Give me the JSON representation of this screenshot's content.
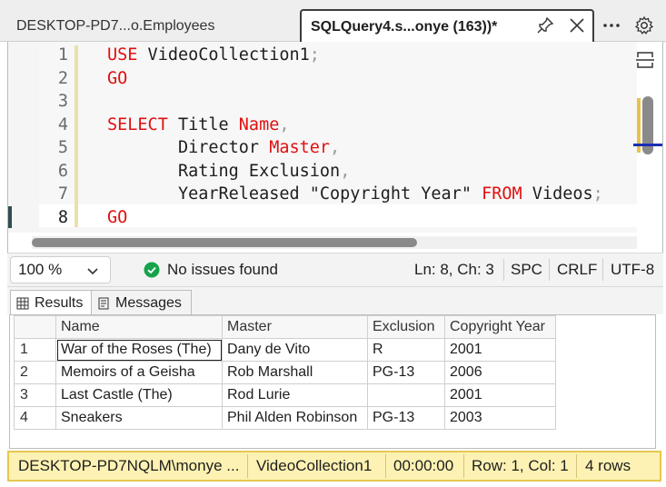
{
  "tabs": {
    "inactive_label": "DESKTOP-PD7...o.Employees",
    "active_label": "SQLQuery4.s...onye (163))*"
  },
  "editor": {
    "line_numbers": [
      "1",
      "2",
      "3",
      "4",
      "5",
      "6",
      "7",
      "8"
    ],
    "lines": [
      [
        {
          "t": "USE",
          "c": "kw"
        },
        {
          "t": " VideoCollection1",
          "c": "id"
        },
        {
          "t": ";",
          "c": "pu"
        }
      ],
      [
        {
          "t": "GO",
          "c": "kw"
        }
      ],
      [],
      [
        {
          "t": "SELECT",
          "c": "kw"
        },
        {
          "t": " Title ",
          "c": "id"
        },
        {
          "t": "Name",
          "c": "kw"
        },
        {
          "t": ",",
          "c": "pu"
        }
      ],
      [
        {
          "t": "       Director ",
          "c": "id"
        },
        {
          "t": "Master",
          "c": "kw"
        },
        {
          "t": ",",
          "c": "pu"
        }
      ],
      [
        {
          "t": "       Rating Exclusion",
          "c": "id"
        },
        {
          "t": ",",
          "c": "pu"
        }
      ],
      [
        {
          "t": "       YearReleased \"Copyright Year\" ",
          "c": "id"
        },
        {
          "t": "FROM",
          "c": "kw"
        },
        {
          "t": " Videos",
          "c": "id"
        },
        {
          "t": ";",
          "c": "pu"
        }
      ],
      [
        {
          "t": "GO",
          "c": "kw"
        }
      ]
    ],
    "current_line": 8
  },
  "editor_status": {
    "zoom": "100 %",
    "issues": "No issues found",
    "cursor": "Ln: 8, Ch: 3",
    "whitespace": "SPC",
    "line_ending": "CRLF",
    "encoding": "UTF-8"
  },
  "result_tabs": {
    "results": "Results",
    "messages": "Messages"
  },
  "grid": {
    "columns": [
      "Name",
      "Master",
      "Exclusion",
      "Copyright Year"
    ],
    "rows": [
      {
        "n": "1",
        "cells": [
          "War of the Roses (The)",
          "Dany de Vito",
          "R",
          "2001"
        ]
      },
      {
        "n": "2",
        "cells": [
          "Memoirs of a Geisha",
          "Rob Marshall",
          "PG-13",
          "2006"
        ]
      },
      {
        "n": "3",
        "cells": [
          "Last Castle (The)",
          "Rod Lurie",
          "",
          "2001"
        ]
      },
      {
        "n": "4",
        "cells": [
          "Sneakers",
          "Phil Alden Robinson",
          "PG-13",
          "2003"
        ]
      }
    ]
  },
  "bottom_status": {
    "server": "DESKTOP-PD7NQLM\\monye ...",
    "database": "VideoCollection1",
    "elapsed": "00:00:00",
    "position": "Row: 1, Col: 1",
    "row_count": "4 rows"
  },
  "colors": {
    "keyword": "#e01010",
    "status_bar": "#fdf2b3",
    "success": "#16a34a"
  }
}
